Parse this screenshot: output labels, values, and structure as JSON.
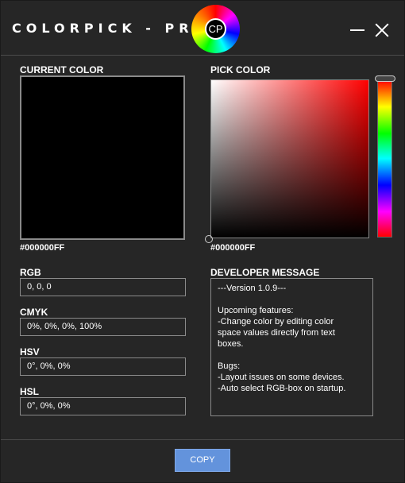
{
  "titlebar": {
    "title": "COLORPICK - PRO",
    "logo_text": "CP",
    "minimize_icon": "minimize-icon",
    "close_icon": "close-icon"
  },
  "current_color": {
    "label": "CURRENT COLOR",
    "hex": "#000000FF",
    "swatch_color": "#000000"
  },
  "pick_color": {
    "label": "PICK COLOR",
    "hex": "#000000FF",
    "hue_color": "#ff0000"
  },
  "fields": {
    "rgb": {
      "label": "RGB",
      "value": "0, 0, 0"
    },
    "cmyk": {
      "label": "CMYK",
      "value": "0%, 0%, 0%, 100%"
    },
    "hsv": {
      "label": "HSV",
      "value": "0°, 0%, 0%"
    },
    "hsl": {
      "label": "HSL",
      "value": "0°, 0%, 0%"
    }
  },
  "developer_message": {
    "label": "DEVELOPER MESSAGE",
    "lines": [
      "---Version 1.0.9---",
      "",
      "Upcoming features:",
      "-Change color by editing color",
      "space values directly from text",
      "boxes.",
      "",
      "Bugs:",
      "-Layout issues on some devices.",
      "-Auto select RGB-box on startup."
    ]
  },
  "copy_button": {
    "label": "COPY"
  },
  "colors": {
    "background": "#262626",
    "accent": "#6393dc",
    "border": "#8a8a8a"
  }
}
